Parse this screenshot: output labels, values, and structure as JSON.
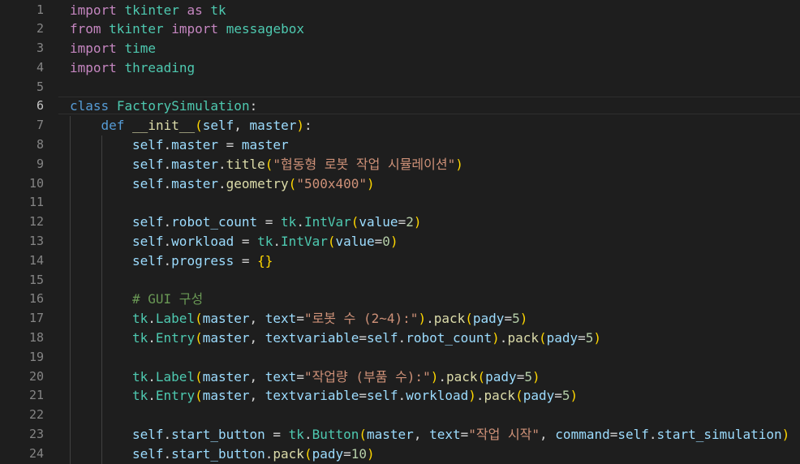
{
  "editor": {
    "active_line": 6,
    "lines": [
      {
        "n": "1",
        "indent": 0,
        "tokens": [
          [
            "kw",
            "import"
          ],
          [
            "op",
            " "
          ],
          [
            "cls",
            "tkinter"
          ],
          [
            "op",
            " "
          ],
          [
            "kw",
            "as"
          ],
          [
            "op",
            " "
          ],
          [
            "cls",
            "tk"
          ]
        ]
      },
      {
        "n": "2",
        "indent": 0,
        "tokens": [
          [
            "kw",
            "from"
          ],
          [
            "op",
            " "
          ],
          [
            "cls",
            "tkinter"
          ],
          [
            "op",
            " "
          ],
          [
            "kw",
            "import"
          ],
          [
            "op",
            " "
          ],
          [
            "cls",
            "messagebox"
          ]
        ]
      },
      {
        "n": "3",
        "indent": 0,
        "tokens": [
          [
            "kw",
            "import"
          ],
          [
            "op",
            " "
          ],
          [
            "cls",
            "time"
          ]
        ]
      },
      {
        "n": "4",
        "indent": 0,
        "tokens": [
          [
            "kw",
            "import"
          ],
          [
            "op",
            " "
          ],
          [
            "cls",
            "threading"
          ]
        ]
      },
      {
        "n": "5",
        "indent": 0,
        "tokens": []
      },
      {
        "n": "6",
        "indent": 0,
        "tokens": [
          [
            "dec",
            "class"
          ],
          [
            "op",
            " "
          ],
          [
            "cls",
            "FactorySimulation"
          ],
          [
            "op",
            ":"
          ]
        ]
      },
      {
        "n": "7",
        "indent": 1,
        "tokens": [
          [
            "dec",
            "def"
          ],
          [
            "op",
            " "
          ],
          [
            "fn",
            "__init__"
          ],
          [
            "par",
            "("
          ],
          [
            "var",
            "self"
          ],
          [
            "op",
            ", "
          ],
          [
            "var",
            "master"
          ],
          [
            "par",
            ")"
          ],
          [
            "op",
            ":"
          ]
        ]
      },
      {
        "n": "8",
        "indent": 2,
        "tokens": [
          [
            "var",
            "self"
          ],
          [
            "op",
            "."
          ],
          [
            "var",
            "master"
          ],
          [
            "op",
            " = "
          ],
          [
            "var",
            "master"
          ]
        ]
      },
      {
        "n": "9",
        "indent": 2,
        "tokens": [
          [
            "var",
            "self"
          ],
          [
            "op",
            "."
          ],
          [
            "var",
            "master"
          ],
          [
            "op",
            "."
          ],
          [
            "fn",
            "title"
          ],
          [
            "par",
            "("
          ],
          [
            "str",
            "\"협동형 로봇 작업 시뮬레이션\""
          ],
          [
            "par",
            ")"
          ]
        ]
      },
      {
        "n": "10",
        "indent": 2,
        "tokens": [
          [
            "var",
            "self"
          ],
          [
            "op",
            "."
          ],
          [
            "var",
            "master"
          ],
          [
            "op",
            "."
          ],
          [
            "fn",
            "geometry"
          ],
          [
            "par",
            "("
          ],
          [
            "str",
            "\"500x400\""
          ],
          [
            "par",
            ")"
          ]
        ]
      },
      {
        "n": "11",
        "indent": 2,
        "tokens": []
      },
      {
        "n": "12",
        "indent": 2,
        "tokens": [
          [
            "var",
            "self"
          ],
          [
            "op",
            "."
          ],
          [
            "var",
            "robot_count"
          ],
          [
            "op",
            " = "
          ],
          [
            "cls",
            "tk"
          ],
          [
            "op",
            "."
          ],
          [
            "cls",
            "IntVar"
          ],
          [
            "par",
            "("
          ],
          [
            "var",
            "value"
          ],
          [
            "op",
            "="
          ],
          [
            "num",
            "2"
          ],
          [
            "par",
            ")"
          ]
        ]
      },
      {
        "n": "13",
        "indent": 2,
        "tokens": [
          [
            "var",
            "self"
          ],
          [
            "op",
            "."
          ],
          [
            "var",
            "workload"
          ],
          [
            "op",
            " = "
          ],
          [
            "cls",
            "tk"
          ],
          [
            "op",
            "."
          ],
          [
            "cls",
            "IntVar"
          ],
          [
            "par",
            "("
          ],
          [
            "var",
            "value"
          ],
          [
            "op",
            "="
          ],
          [
            "num",
            "0"
          ],
          [
            "par",
            ")"
          ]
        ]
      },
      {
        "n": "14",
        "indent": 2,
        "tokens": [
          [
            "var",
            "self"
          ],
          [
            "op",
            "."
          ],
          [
            "var",
            "progress"
          ],
          [
            "op",
            " = "
          ],
          [
            "par",
            "{}"
          ]
        ]
      },
      {
        "n": "15",
        "indent": 2,
        "tokens": []
      },
      {
        "n": "16",
        "indent": 2,
        "tokens": [
          [
            "cmt",
            "# GUI 구성"
          ]
        ]
      },
      {
        "n": "17",
        "indent": 2,
        "tokens": [
          [
            "cls",
            "tk"
          ],
          [
            "op",
            "."
          ],
          [
            "cls",
            "Label"
          ],
          [
            "par",
            "("
          ],
          [
            "var",
            "master"
          ],
          [
            "op",
            ", "
          ],
          [
            "var",
            "text"
          ],
          [
            "op",
            "="
          ],
          [
            "str",
            "\"로봇 수 (2~4):\""
          ],
          [
            "par",
            ")"
          ],
          [
            "op",
            "."
          ],
          [
            "fn",
            "pack"
          ],
          [
            "par",
            "("
          ],
          [
            "var",
            "pady"
          ],
          [
            "op",
            "="
          ],
          [
            "num",
            "5"
          ],
          [
            "par",
            ")"
          ]
        ]
      },
      {
        "n": "18",
        "indent": 2,
        "tokens": [
          [
            "cls",
            "tk"
          ],
          [
            "op",
            "."
          ],
          [
            "cls",
            "Entry"
          ],
          [
            "par",
            "("
          ],
          [
            "var",
            "master"
          ],
          [
            "op",
            ", "
          ],
          [
            "var",
            "textvariable"
          ],
          [
            "op",
            "="
          ],
          [
            "var",
            "self"
          ],
          [
            "op",
            "."
          ],
          [
            "var",
            "robot_count"
          ],
          [
            "par",
            ")"
          ],
          [
            "op",
            "."
          ],
          [
            "fn",
            "pack"
          ],
          [
            "par",
            "("
          ],
          [
            "var",
            "pady"
          ],
          [
            "op",
            "="
          ],
          [
            "num",
            "5"
          ],
          [
            "par",
            ")"
          ]
        ]
      },
      {
        "n": "19",
        "indent": 2,
        "tokens": []
      },
      {
        "n": "20",
        "indent": 2,
        "tokens": [
          [
            "cls",
            "tk"
          ],
          [
            "op",
            "."
          ],
          [
            "cls",
            "Label"
          ],
          [
            "par",
            "("
          ],
          [
            "var",
            "master"
          ],
          [
            "op",
            ", "
          ],
          [
            "var",
            "text"
          ],
          [
            "op",
            "="
          ],
          [
            "str",
            "\"작업량 (부품 수):\""
          ],
          [
            "par",
            ")"
          ],
          [
            "op",
            "."
          ],
          [
            "fn",
            "pack"
          ],
          [
            "par",
            "("
          ],
          [
            "var",
            "pady"
          ],
          [
            "op",
            "="
          ],
          [
            "num",
            "5"
          ],
          [
            "par",
            ")"
          ]
        ]
      },
      {
        "n": "21",
        "indent": 2,
        "tokens": [
          [
            "cls",
            "tk"
          ],
          [
            "op",
            "."
          ],
          [
            "cls",
            "Entry"
          ],
          [
            "par",
            "("
          ],
          [
            "var",
            "master"
          ],
          [
            "op",
            ", "
          ],
          [
            "var",
            "textvariable"
          ],
          [
            "op",
            "="
          ],
          [
            "var",
            "self"
          ],
          [
            "op",
            "."
          ],
          [
            "var",
            "workload"
          ],
          [
            "par",
            ")"
          ],
          [
            "op",
            "."
          ],
          [
            "fn",
            "pack"
          ],
          [
            "par",
            "("
          ],
          [
            "var",
            "pady"
          ],
          [
            "op",
            "="
          ],
          [
            "num",
            "5"
          ],
          [
            "par",
            ")"
          ]
        ]
      },
      {
        "n": "22",
        "indent": 2,
        "tokens": []
      },
      {
        "n": "23",
        "indent": 2,
        "tokens": [
          [
            "var",
            "self"
          ],
          [
            "op",
            "."
          ],
          [
            "var",
            "start_button"
          ],
          [
            "op",
            " = "
          ],
          [
            "cls",
            "tk"
          ],
          [
            "op",
            "."
          ],
          [
            "cls",
            "Button"
          ],
          [
            "par",
            "("
          ],
          [
            "var",
            "master"
          ],
          [
            "op",
            ", "
          ],
          [
            "var",
            "text"
          ],
          [
            "op",
            "="
          ],
          [
            "str",
            "\"작업 시작\""
          ],
          [
            "op",
            ", "
          ],
          [
            "var",
            "command"
          ],
          [
            "op",
            "="
          ],
          [
            "var",
            "self"
          ],
          [
            "op",
            "."
          ],
          [
            "var",
            "start_simulation"
          ],
          [
            "par",
            ")"
          ]
        ]
      },
      {
        "n": "24",
        "indent": 2,
        "tokens": [
          [
            "var",
            "self"
          ],
          [
            "op",
            "."
          ],
          [
            "var",
            "start_button"
          ],
          [
            "op",
            "."
          ],
          [
            "fn",
            "pack"
          ],
          [
            "par",
            "("
          ],
          [
            "var",
            "pady"
          ],
          [
            "op",
            "="
          ],
          [
            "num",
            "10"
          ],
          [
            "par",
            ")"
          ]
        ]
      }
    ]
  }
}
